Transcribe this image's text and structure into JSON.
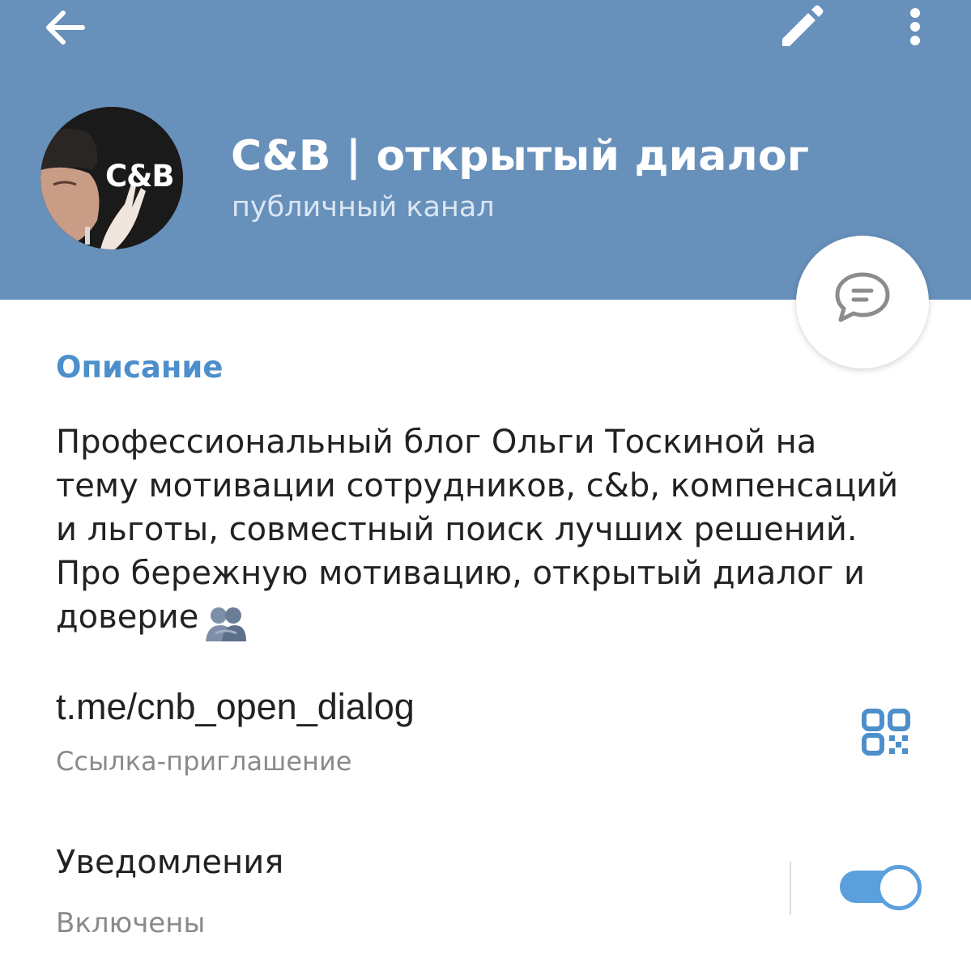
{
  "header": {
    "title": "C&B | открытый диалог",
    "subtitle": "публичный канал",
    "avatar_text": "C&B",
    "background_color": "#6790bb",
    "icons": [
      "arrow-left-icon",
      "pencil-icon",
      "more-vertical-icon",
      "chat-icon"
    ]
  },
  "description": {
    "section_title": "Описание",
    "text": "Профессиональный блог Ольги Тоскиной на\nтему мотивации сотрудников, c&b, компенсаций\nи льготы, совместный поиск лучших решений.\nПро бережную мотивацию, открытый диалог и\nдоверие",
    "emoji": "🫂"
  },
  "invite_link": {
    "url": "t.me/cnb_open_dialog",
    "caption": "Ссылка-приглашение",
    "icon": "qr-code-icon"
  },
  "notifications": {
    "label": "Уведомления",
    "status": "Включены",
    "enabled": true
  },
  "colors": {
    "accent": "#4d8fcb",
    "toggle": "#5aa0dc"
  }
}
